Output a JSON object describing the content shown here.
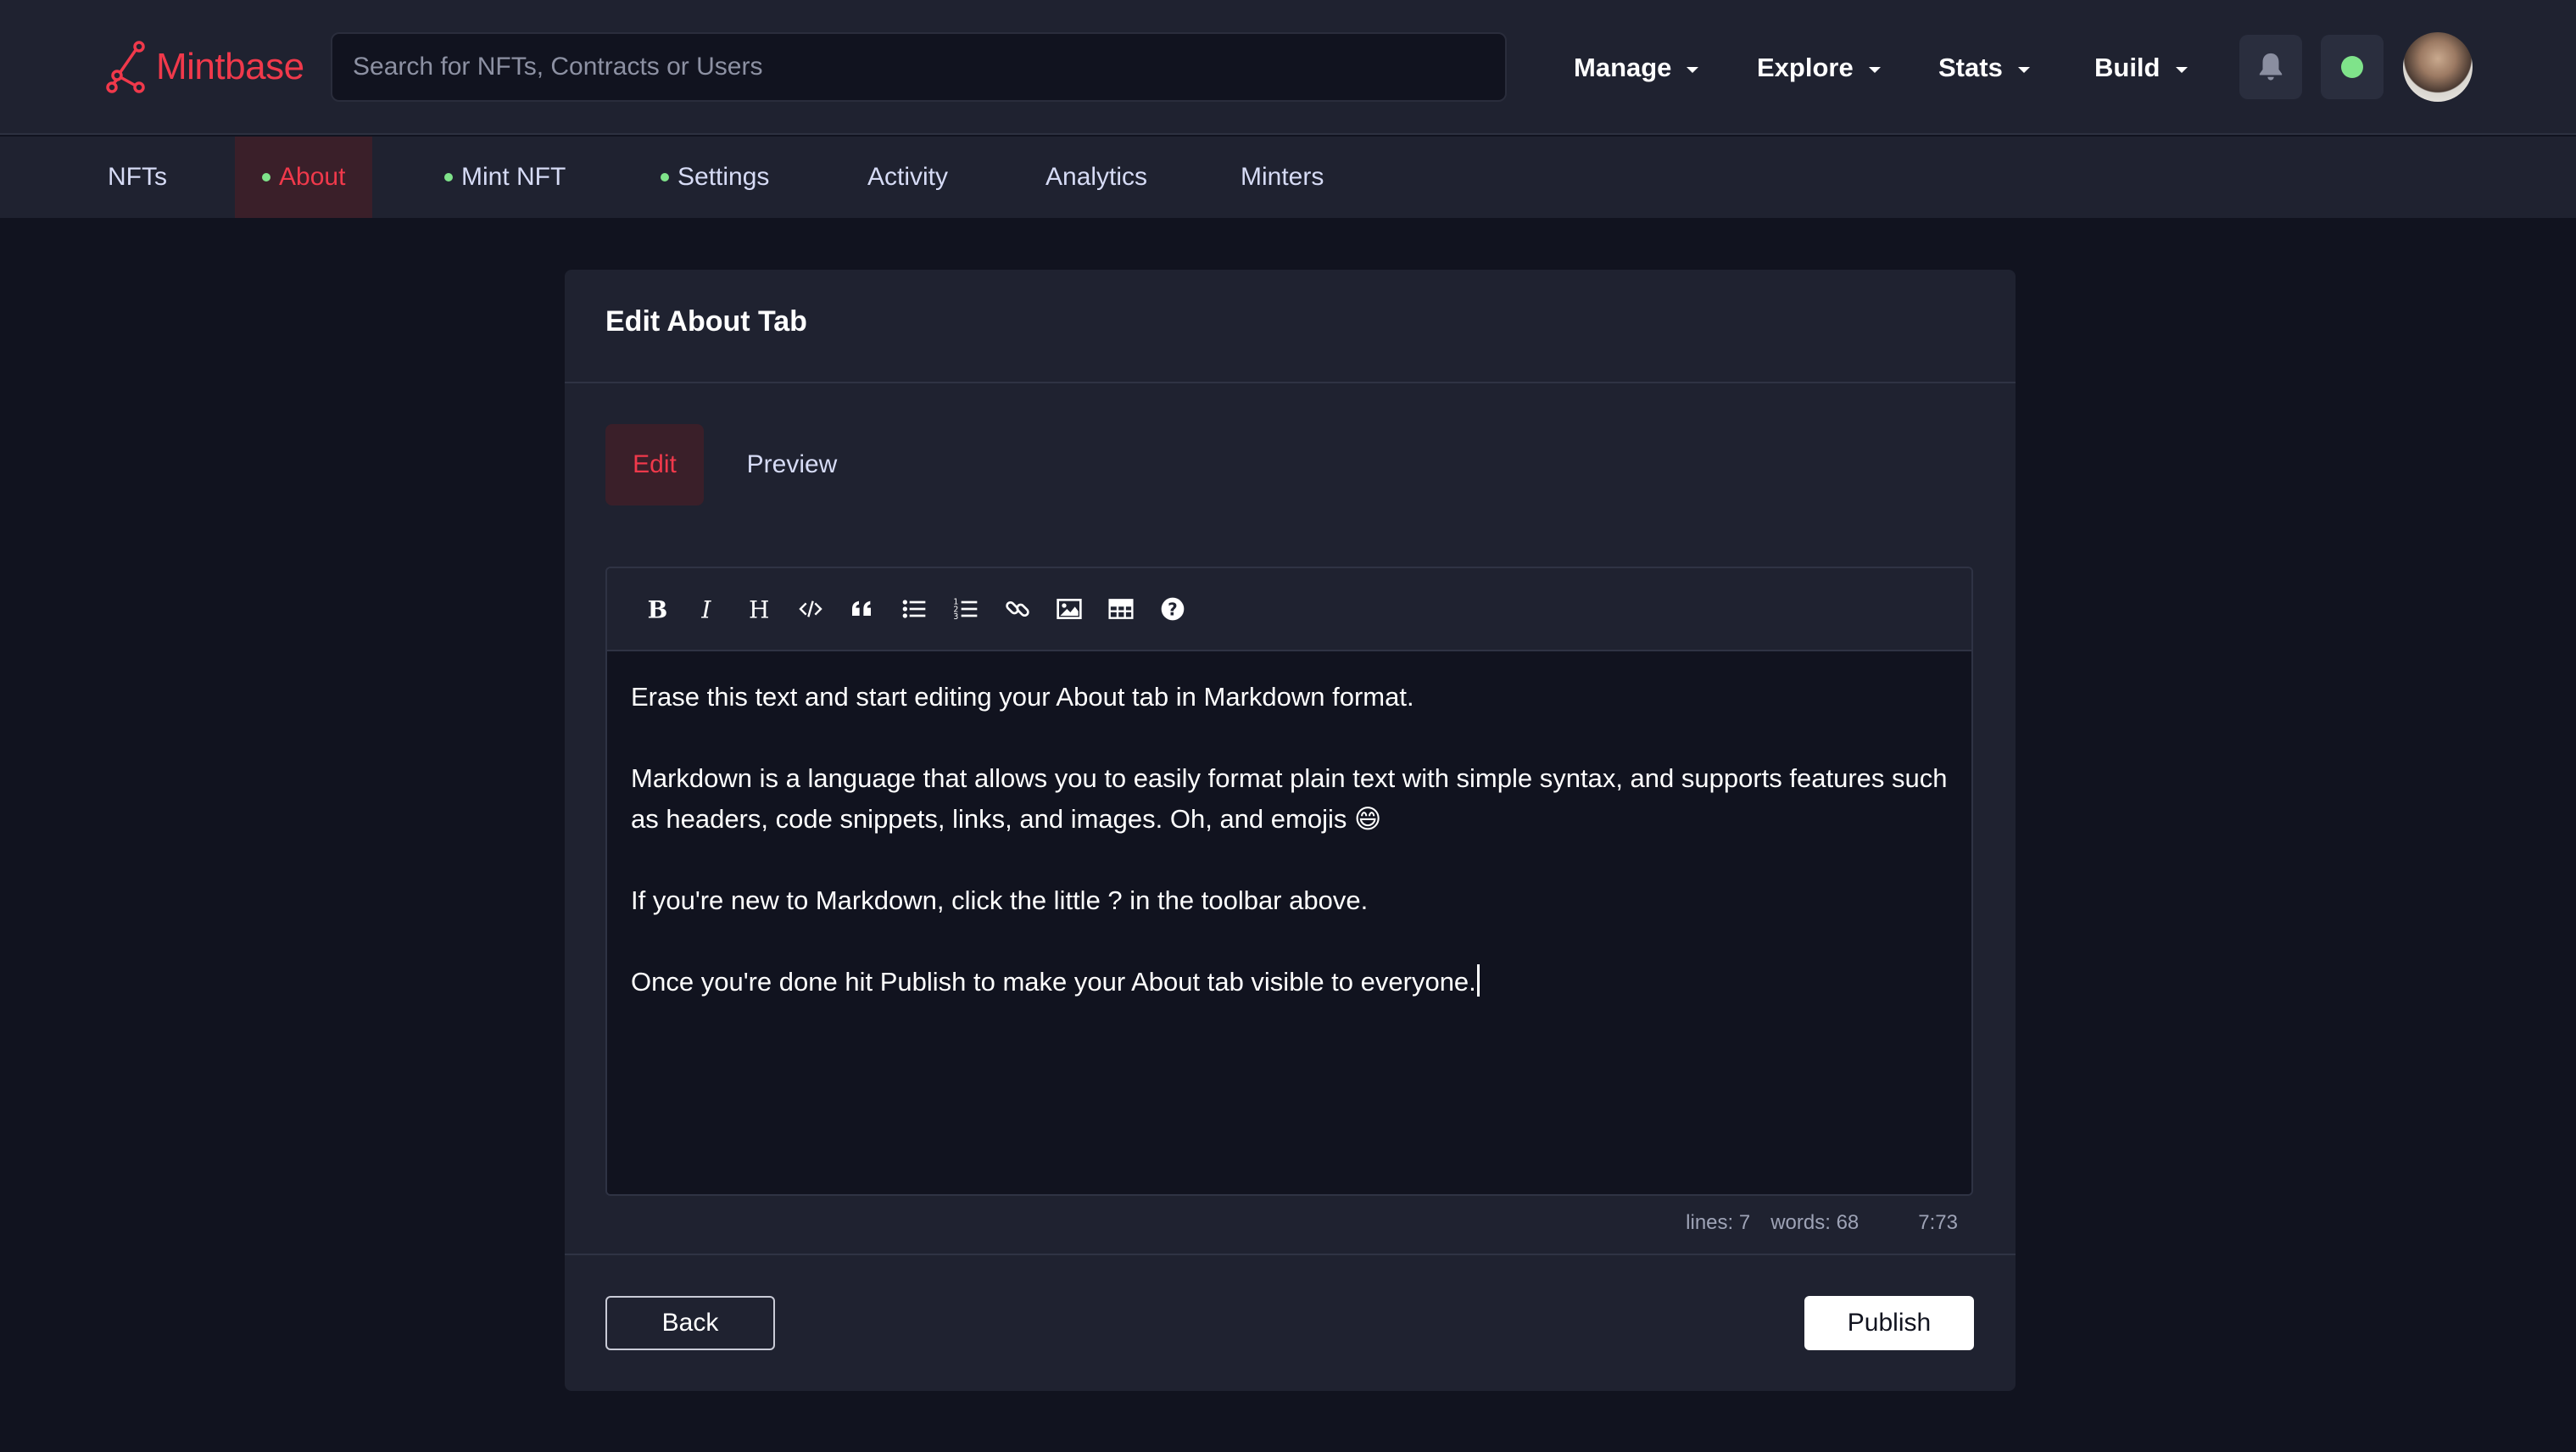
{
  "header": {
    "logo_text": "Mintbase",
    "search_placeholder": "Search for NFTs, Contracts or Users",
    "menu": [
      {
        "label": "Manage"
      },
      {
        "label": "Explore"
      },
      {
        "label": "Stats"
      },
      {
        "label": "Build"
      }
    ],
    "brand_color": "#f0394b",
    "status_color": "#7fe38a"
  },
  "subnav": {
    "tabs": [
      {
        "label": "NFTs"
      },
      {
        "label": "About"
      },
      {
        "label": "Mint NFT"
      },
      {
        "label": "Settings"
      },
      {
        "label": "Activity"
      },
      {
        "label": "Analytics"
      },
      {
        "label": "Minters"
      }
    ]
  },
  "card": {
    "title": "Edit About Tab",
    "edit_tab": "Edit",
    "preview_tab": "Preview",
    "toolbar_icons": [
      "bold-icon",
      "italic-icon",
      "heading-icon",
      "code-icon",
      "quote-icon",
      "bullet-list-icon",
      "numbered-list-icon",
      "link-icon",
      "image-icon",
      "table-icon",
      "help-icon"
    ],
    "content": {
      "p1": "Erase this text and start editing your About tab in Markdown format.",
      "p2": "Markdown is a language that allows you to easily format plain text with simple syntax, and supports features such as headers, code snippets, links, and images. Oh, and emojis 😄",
      "p3": "If you're new to Markdown, click the little ? in the toolbar above.",
      "p4": "Once you're done hit Publish to make your About tab visible to everyone."
    },
    "status": {
      "lines": "lines: 7",
      "words": "words: 68",
      "cursor": "7:73"
    },
    "back_label": "Back",
    "publish_label": "Publish"
  }
}
